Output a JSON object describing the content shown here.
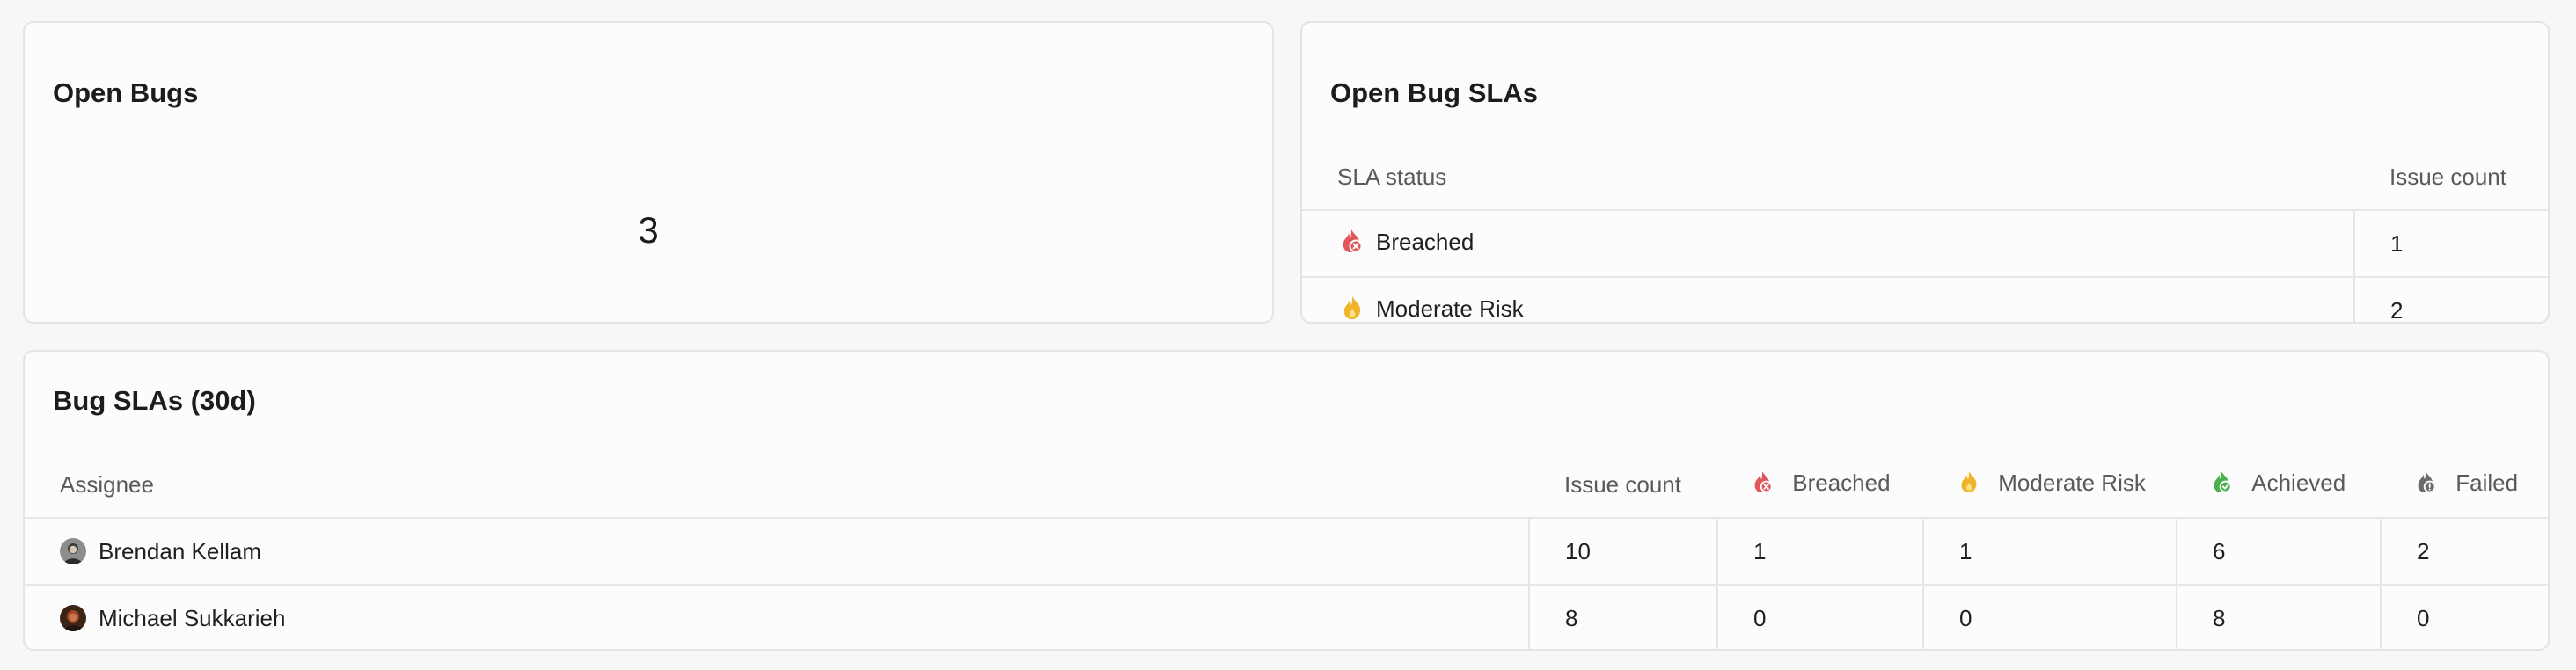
{
  "open_bugs": {
    "title": "Open Bugs",
    "count": "3"
  },
  "open_bug_slas": {
    "title": "Open Bug SLAs",
    "headers": {
      "status": "SLA status",
      "count": "Issue count"
    },
    "rows": [
      {
        "icon": "flame-x-icon",
        "status": "Breached",
        "count": "1"
      },
      {
        "icon": "flame-icon",
        "status": "Moderate Risk",
        "count": "2"
      }
    ]
  },
  "bug_slas_30d": {
    "title": "Bug SLAs (30d)",
    "headers": {
      "assignee": "Assignee",
      "issue_count": "Issue count",
      "breached": "Breached",
      "moderate_risk": "Moderate Risk",
      "achieved": "Achieved",
      "failed": "Failed"
    },
    "rows": [
      {
        "assignee": "Brendan Kellam",
        "issue_count": "10",
        "breached": "1",
        "moderate_risk": "1",
        "achieved": "6",
        "failed": "2"
      },
      {
        "assignee": "Michael Sukkarieh",
        "issue_count": "8",
        "breached": "0",
        "moderate_risk": "0",
        "achieved": "8",
        "failed": "0"
      }
    ]
  },
  "colors": {
    "breached": "#e0565b",
    "moderate_risk": "#f0b429",
    "achieved": "#4caf50",
    "failed": "#6b6b6b"
  }
}
